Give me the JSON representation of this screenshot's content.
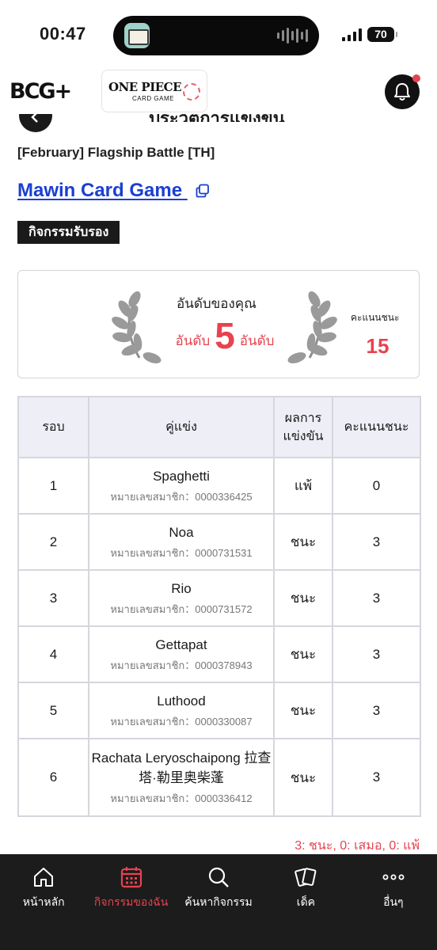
{
  "status_bar": {
    "time": "00:47",
    "battery": "70"
  },
  "header": {
    "logo_text": "BCG+",
    "op_logo_line1": "ONE PIECE",
    "op_logo_line2": "CARD GAME"
  },
  "page": {
    "title": "ประวัติการแข่งขัน",
    "event_name": "[February] Flagship Battle [TH]",
    "shop_name": "Mawin Card Game",
    "badge": "กิจกรรมรับรอง"
  },
  "rank_card": {
    "your_rank_label": "อันดับของคุณ",
    "rank_prefix": "อันดับ",
    "rank_number": "5",
    "rank_suffix": "อันดับ",
    "wins_label": "คะแนนชนะ",
    "wins_value": "15"
  },
  "table": {
    "headers": [
      "รอบ",
      "คู่แข่ง",
      "ผลการแข่งขัน",
      "คะแนนชนะ"
    ],
    "member_prefix": "หมายเลขสมาชิก：",
    "rows": [
      {
        "round": "1",
        "name": "Spaghetti",
        "member": "หมายเลขสมาชิก：0000336425",
        "result": "แพ้",
        "points": "0"
      },
      {
        "round": "2",
        "name": "Noa",
        "member": "หมายเลขสมาชิก：0000731531",
        "result": "ชนะ",
        "points": "3"
      },
      {
        "round": "3",
        "name": "Rio",
        "member": "หมายเลขสมาชิก：0000731572",
        "result": "ชนะ",
        "points": "3"
      },
      {
        "round": "4",
        "name": "Gettapat",
        "member": "หมายเลขสมาชิก：0000378943",
        "result": "ชนะ",
        "points": "3"
      },
      {
        "round": "5",
        "name": "Luthood",
        "member": "หมายเลขสมาชิก：0000330087",
        "result": "ชนะ",
        "points": "3"
      },
      {
        "round": "6",
        "name": "Rachata Leryoschaipong 拉查塔·勒里奥柴蓬",
        "member": "หมายเลขสมาชิก：0000336412",
        "result": "ชนะ",
        "points": "3"
      }
    ]
  },
  "summary": "3: ชนะ, 0: เสมอ, 0: แพ้",
  "bottom_nav": [
    {
      "label": "หน้าหลัก",
      "icon": "home-icon",
      "active": false
    },
    {
      "label": "กิจกรรมของฉัน",
      "icon": "calendar-icon",
      "active": true
    },
    {
      "label": "ค้นหากิจกรรม",
      "icon": "search-icon",
      "active": false
    },
    {
      "label": "เด็ค",
      "icon": "cards-icon",
      "active": false
    },
    {
      "label": "อื่นๆ",
      "icon": "more-icon",
      "active": false
    }
  ],
  "colors": {
    "accent": "#e8424f",
    "link": "#1a3fd1",
    "nav_bg": "#1c1c1c",
    "table_header_bg": "#eeeef6"
  }
}
